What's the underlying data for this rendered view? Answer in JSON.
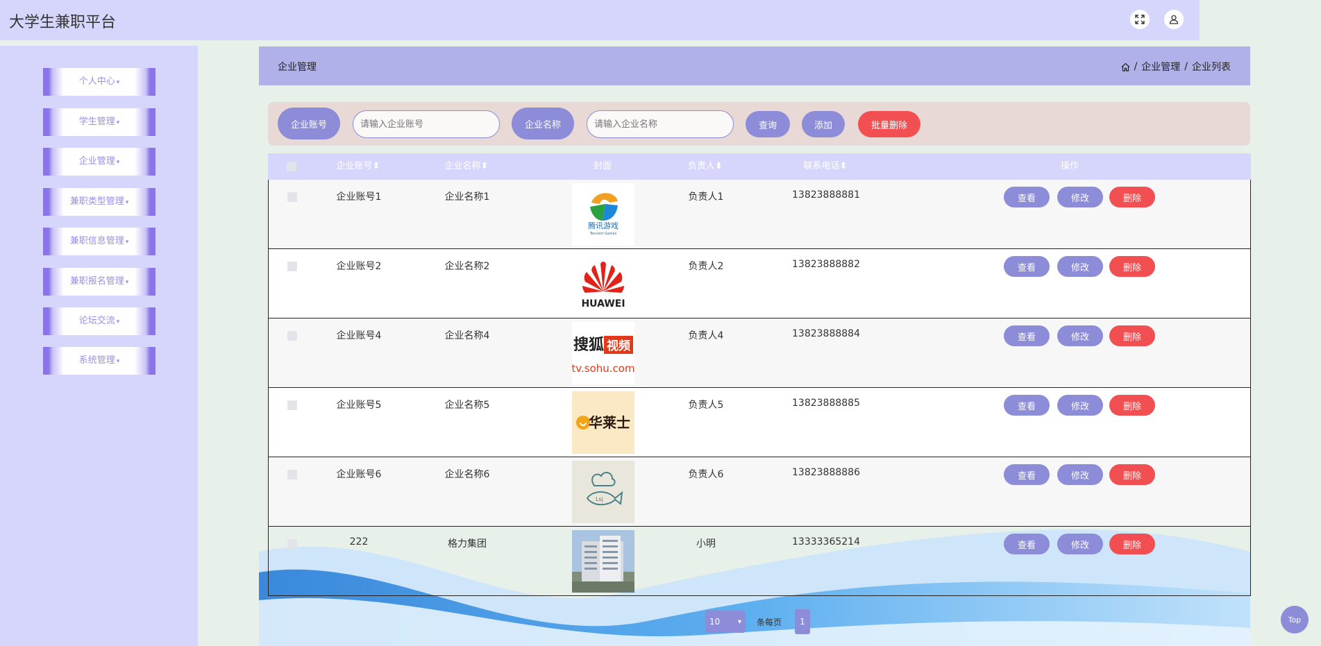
{
  "app": {
    "title": "大学生兼职平台"
  },
  "topbar": {
    "fullscreen_icon": "expand-icon",
    "user_icon": "user-icon"
  },
  "sidebar": {
    "items": [
      {
        "label": "个人中心"
      },
      {
        "label": "学生管理"
      },
      {
        "label": "企业管理"
      },
      {
        "label": "兼职类型管理"
      },
      {
        "label": "兼职信息管理"
      },
      {
        "label": "兼职报名管理"
      },
      {
        "label": "论坛交流"
      },
      {
        "label": "系统管理"
      }
    ]
  },
  "header": {
    "title": "企业管理",
    "breadcrumb": [
      "企业管理",
      "企业列表"
    ]
  },
  "search": {
    "account_label": "企业账号",
    "account_placeholder": "请输入企业账号",
    "name_label": "企业名称",
    "name_placeholder": "请输入企业名称",
    "query_label": "查询",
    "add_label": "添加",
    "batch_delete_label": "批量删除"
  },
  "table": {
    "columns": [
      "企业账号",
      "企业名称",
      "封面",
      "负责人",
      "联系电话",
      "操作"
    ],
    "rows": [
      {
        "account": "企业账号1",
        "name": "企业名称1",
        "cover": "tencent-games-logo",
        "manager": "负责人1",
        "phone": "13823888881"
      },
      {
        "account": "企业账号2",
        "name": "企业名称2",
        "cover": "huawei-logo",
        "manager": "负责人2",
        "phone": "13823888882"
      },
      {
        "account": "企业账号4",
        "name": "企业名称4",
        "cover": "sohu-video-logo",
        "manager": "负责人4",
        "phone": "13823888884"
      },
      {
        "account": "企业账号5",
        "name": "企业名称5",
        "cover": "hualaishi-logo",
        "manager": "负责人5",
        "phone": "13823888885"
      },
      {
        "account": "企业账号6",
        "name": "企业名称6",
        "cover": "chef-fish-logo",
        "manager": "负责人6",
        "phone": "13823888886"
      },
      {
        "account": "222",
        "name": "格力集团",
        "cover": "building-photo",
        "manager": "小明",
        "phone": "13333365214"
      }
    ],
    "actions": {
      "view": "查看",
      "edit": "修改",
      "delete": "删除"
    }
  },
  "pagination": {
    "page_size": "10",
    "per_page_label": "条每页",
    "current_page": "1"
  },
  "back_to_top": "Top",
  "colors": {
    "accent": "#8c8cd8",
    "danger": "#f24f53",
    "header_bg": "#d6d6fd",
    "card_bg": "#b1b1e9"
  },
  "logo_text": {
    "tencent": "腾讯游戏",
    "tencent_en": "Tencent Games",
    "huawei": "HUAWEI",
    "sohu_cn": "搜狐",
    "sohu_box": "视频",
    "sohu_url": "tv.sohu.com",
    "hualaishi": "华莱士",
    "chef": "Lsj"
  }
}
